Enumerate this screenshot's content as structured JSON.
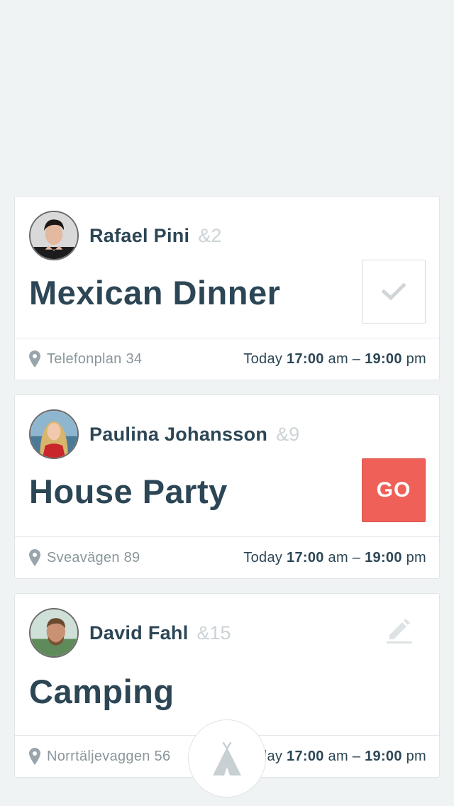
{
  "events": [
    {
      "host": {
        "name": "Rafael Pini",
        "count": "&2"
      },
      "title": "Mexican Dinner",
      "action": {
        "type": "check-icon"
      },
      "location": "Telefonplan 34",
      "time": {
        "day": "Today",
        "start": "17:00",
        "start_suffix": "am",
        "sep": "–",
        "end": "19:00",
        "end_suffix": "pm"
      }
    },
    {
      "host": {
        "name": "Paulina Johansson",
        "count": "&9"
      },
      "title": "House Party",
      "action": {
        "type": "go",
        "label": "GO",
        "color": "#ee6058"
      },
      "location": "Sveavägen 89",
      "time": {
        "day": "Today",
        "start": "17:00",
        "start_suffix": "am",
        "sep": "–",
        "end": "19:00",
        "end_suffix": "pm"
      }
    },
    {
      "host": {
        "name": "David Fahl",
        "count": "&15"
      },
      "title": "Camping",
      "action": {
        "type": "pencil-icon"
      },
      "location": "Norrtäljevaggen 56",
      "time": {
        "day": "Today",
        "start": "17:00",
        "start_suffix": "am",
        "sep": "–",
        "end": "19:00",
        "end_suffix": "pm"
      }
    }
  ],
  "fab": {
    "icon": "tent-icon"
  },
  "colors": {
    "accent": "#ee6058",
    "text": "#2c4655",
    "muted": "#8a969c",
    "background": "#f0f3f4"
  }
}
